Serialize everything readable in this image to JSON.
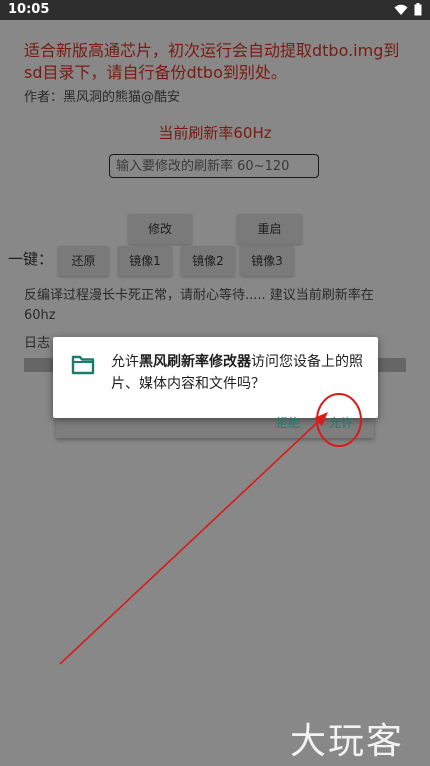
{
  "status": {
    "time": "10:05"
  },
  "notice": "适合新版高通芯片，初次运行会自动提取dtbo.img到sd目录下，请自行备份dtbo到别处。",
  "author": "作者：黑风洞的熊猫@酷安",
  "current_rate": "当前刷新率60Hz",
  "rate_input": {
    "placeholder": "输入要修改的刷新率 60~120"
  },
  "buttons": {
    "modify": "修改",
    "reboot": "重启"
  },
  "onekey": {
    "label": "一键：",
    "restore": "还原",
    "image1": "镜像1",
    "image2": "镜像2",
    "image3": "镜像3"
  },
  "log": {
    "text": "反编译过程漫长卡死正常，请耐心等待..... 建议当前刷新率在60hz",
    "label": "日志"
  },
  "dialog": {
    "msg_prefix": "允许",
    "app_name": "黑风刷新率修改器",
    "msg_suffix": "访问您设备上的照片、媒体内容和文件吗？",
    "deny": "拒绝",
    "allow": "允许"
  },
  "watermark": "大玩客",
  "colors": {
    "accent": "#1a7c6c",
    "notice": "#7a1a10",
    "annotation": "#d81b1b"
  }
}
